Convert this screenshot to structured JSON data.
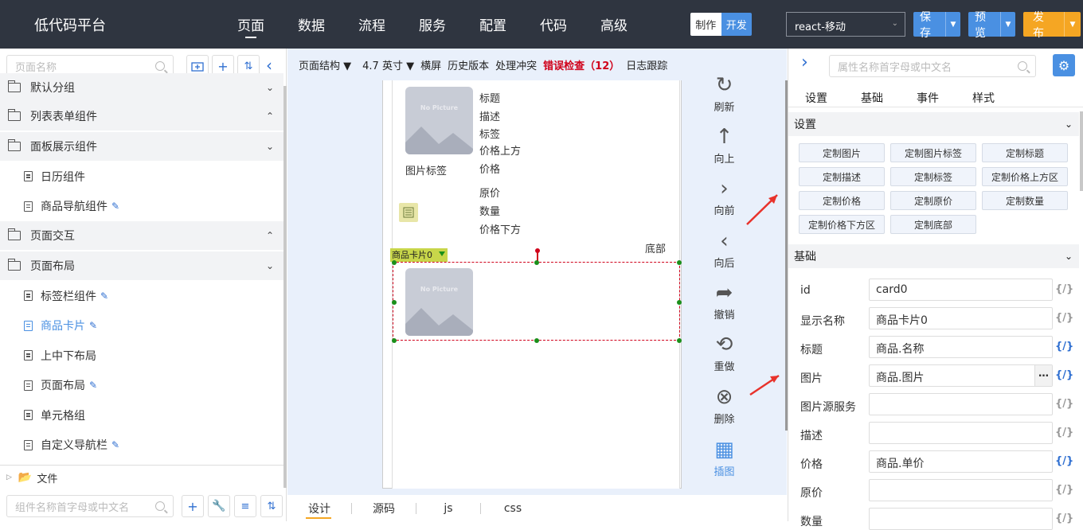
{
  "header": {
    "title": "低代码平台",
    "nav": [
      "页面",
      "数据",
      "流程",
      "服务",
      "配置",
      "代码",
      "高级"
    ],
    "mode": {
      "make": "制作",
      "dev": "开发"
    },
    "platform": "react-移动",
    "save": "保存",
    "preview": "预览",
    "publish": "发布"
  },
  "left": {
    "search_placeholder": "页面名称",
    "tree": [
      {
        "type": "group",
        "label": "默认分组",
        "expanded": false
      },
      {
        "type": "group",
        "label": "列表表单组件",
        "expanded": true
      },
      {
        "type": "group",
        "label": "面板展示组件",
        "expanded": false
      },
      {
        "type": "item",
        "label": "日历组件",
        "editable": false
      },
      {
        "type": "item",
        "label": "商品导航组件",
        "editable": true
      },
      {
        "type": "group",
        "label": "页面交互",
        "expanded": true
      },
      {
        "type": "group",
        "label": "页面布局",
        "expanded": false
      },
      {
        "type": "item",
        "label": "标签栏组件",
        "editable": true
      },
      {
        "type": "item",
        "label": "商品卡片",
        "editable": true,
        "active": true
      },
      {
        "type": "item",
        "label": "上中下布局",
        "editable": false
      },
      {
        "type": "item",
        "label": "页面布局",
        "editable": true
      },
      {
        "type": "item",
        "label": "单元格组",
        "editable": false
      },
      {
        "type": "item",
        "label": "自定义导航栏",
        "editable": true
      }
    ],
    "file_label": "文件",
    "component_search_placeholder": "组件名称首字母或中文名"
  },
  "toolbar": {
    "structure": "页面结构",
    "size": "4.7 英寸",
    "landscape": "横屏",
    "history": "历史版本",
    "conflict": "处理冲突",
    "errors": "错误检查（12）",
    "log": "日志跟踪"
  },
  "card": {
    "no_picture": "No Picture",
    "fields": [
      "标题",
      "描述",
      "标签",
      "价格上方",
      "价格"
    ],
    "image_tag": "图片标签",
    "fields2": [
      "原价",
      "数量",
      "价格下方"
    ],
    "bottom": "底部",
    "selected_tag": "商品卡片0"
  },
  "actions": [
    {
      "label": "刷新",
      "icon": "refresh-icon"
    },
    {
      "label": "向上",
      "icon": "arrow-up-icon"
    },
    {
      "label": "向前",
      "icon": "chevron-right-icon"
    },
    {
      "label": "向后",
      "icon": "chevron-left-icon"
    },
    {
      "label": "撤销",
      "icon": "undo-icon"
    },
    {
      "label": "重做",
      "icon": "redo-icon"
    },
    {
      "label": "删除",
      "icon": "delete-icon"
    },
    {
      "label": "插图",
      "icon": "image-icon"
    }
  ],
  "bottom_tabs": [
    "设计",
    "源码",
    "js",
    "css"
  ],
  "right": {
    "search_placeholder": "属性名称首字母或中文名",
    "tabs": [
      "设置",
      "基础",
      "事件",
      "样式"
    ],
    "settings_title": "设置",
    "custom_buttons": [
      "定制图片",
      "定制图片标签",
      "定制标题",
      "定制描述",
      "定制标签",
      "定制价格上方区",
      "定制价格",
      "定制原价",
      "定制数量",
      "定制价格下方区",
      "定制底部"
    ],
    "basic_title": "基础",
    "props": [
      {
        "label": "id",
        "value": "card0",
        "code": "{/}",
        "bound": false
      },
      {
        "label": "显示名称",
        "value": "商品卡片0",
        "code": "{/}",
        "bound": false
      },
      {
        "label": "标题",
        "value": "商品.名称",
        "code": "{/}",
        "bound": true
      },
      {
        "label": "图片",
        "value": "商品.图片",
        "code": "{/}",
        "bound": true
      },
      {
        "label": "图片源服务",
        "value": "",
        "code": "{/}",
        "bound": false
      },
      {
        "label": "描述",
        "value": "",
        "code": "{/}",
        "bound": false
      },
      {
        "label": "价格",
        "value": "商品.单价",
        "code": "{/}",
        "bound": true
      },
      {
        "label": "原价",
        "value": "",
        "code": "{/}",
        "bound": false
      },
      {
        "label": "数量",
        "value": "",
        "code": "{/}",
        "bound": false
      }
    ]
  },
  "colors": {
    "topbar": "#2f3540",
    "accent": "#4a90e2",
    "publish": "#f5a623",
    "error": "#d0021b"
  }
}
